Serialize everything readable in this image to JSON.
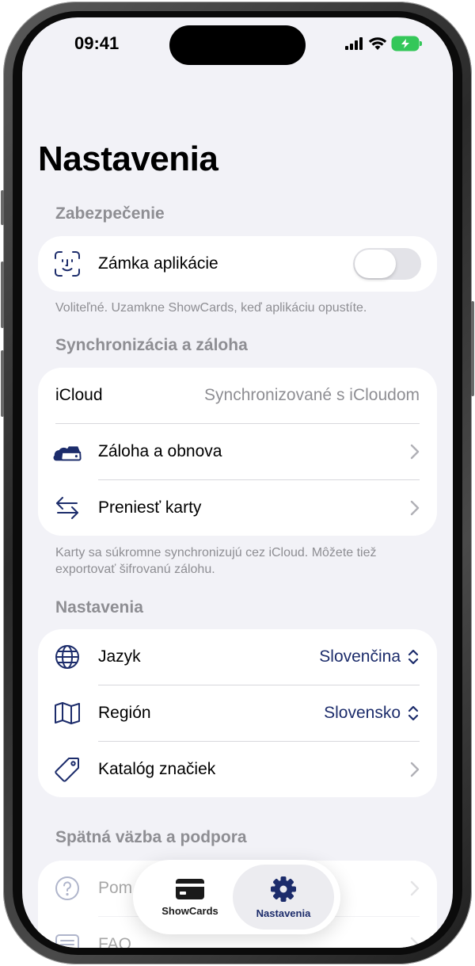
{
  "status_bar": {
    "time": "09:41"
  },
  "page": {
    "title": "Nastavenia"
  },
  "sections": {
    "security": {
      "header": "Zabezpečenie",
      "app_lock": {
        "label": "Zámka aplikácie",
        "icon": "face-id-icon",
        "enabled": false
      },
      "footnote": "Voliteľné. Uzamkne ShowCards, keď aplikáciu opustíte."
    },
    "sync": {
      "header": "Synchronizácia a záloha",
      "icloud": {
        "label": "iCloud",
        "value": "Synchronizované s iCloudom"
      },
      "backup": {
        "label": "Záloha a obnova",
        "icon": "cloud-drive-icon"
      },
      "transfer": {
        "label": "Preniesť karty",
        "icon": "transfer-arrows-icon"
      },
      "footnote": "Karty sa súkromne synchronizujú cez iCloud. Môžete tiež exportovať šifrovanú zálohu."
    },
    "settings": {
      "header": "Nastavenia",
      "language": {
        "label": "Jazyk",
        "value": "Slovenčina",
        "icon": "globe-icon"
      },
      "region": {
        "label": "Región",
        "value": "Slovensko",
        "icon": "map-icon"
      },
      "brands": {
        "label": "Katalóg značiek",
        "icon": "tag-icon"
      }
    },
    "support": {
      "header": "Spätná väzba a podpora",
      "help": {
        "label": "Pom",
        "icon": "question-icon"
      },
      "faq": {
        "label": "FAQ",
        "icon": "list-icon"
      }
    }
  },
  "tab_bar": {
    "tabs": [
      {
        "label": "ShowCards",
        "icon": "card-icon",
        "active": false
      },
      {
        "label": "Nastavenia",
        "icon": "gear-icon",
        "active": true
      }
    ]
  },
  "colors": {
    "accent": "#1c2c6b",
    "secondary_text": "#8e8e93",
    "background": "#f2f2f7",
    "battery": "#34c759"
  }
}
